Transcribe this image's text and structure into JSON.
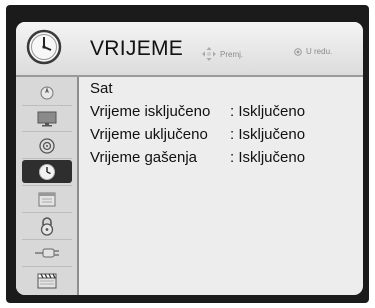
{
  "header": {
    "title": "VRIJEME",
    "hint_move": "Premj.",
    "hint_ok": "U redu.",
    "title_icon": "clock-icon"
  },
  "sidebar": {
    "items": [
      {
        "icon": "picture-icon",
        "active": false
      },
      {
        "icon": "monitor-icon",
        "active": false
      },
      {
        "icon": "audio-disc-icon",
        "active": false
      },
      {
        "icon": "clock-icon",
        "active": true
      },
      {
        "icon": "calendar-icon",
        "active": false
      },
      {
        "icon": "lock-icon",
        "active": false
      },
      {
        "icon": "plug-icon",
        "active": false
      },
      {
        "icon": "clapperboard-icon",
        "active": false
      }
    ]
  },
  "content": {
    "rows": [
      {
        "label": "Sat",
        "value": ""
      },
      {
        "label": "Vrijeme isključeno",
        "value": ": Isključeno"
      },
      {
        "label": "Vrijeme uključeno",
        "value": ": Isključeno"
      },
      {
        "label": "Vrijeme gašenja",
        "value": ": Isključeno"
      }
    ]
  },
  "colors": {
    "frame": "#1b1b1b",
    "panel": "#ededed",
    "sidebar": "#d8d8d8",
    "active_item": "#2e2e2e"
  }
}
